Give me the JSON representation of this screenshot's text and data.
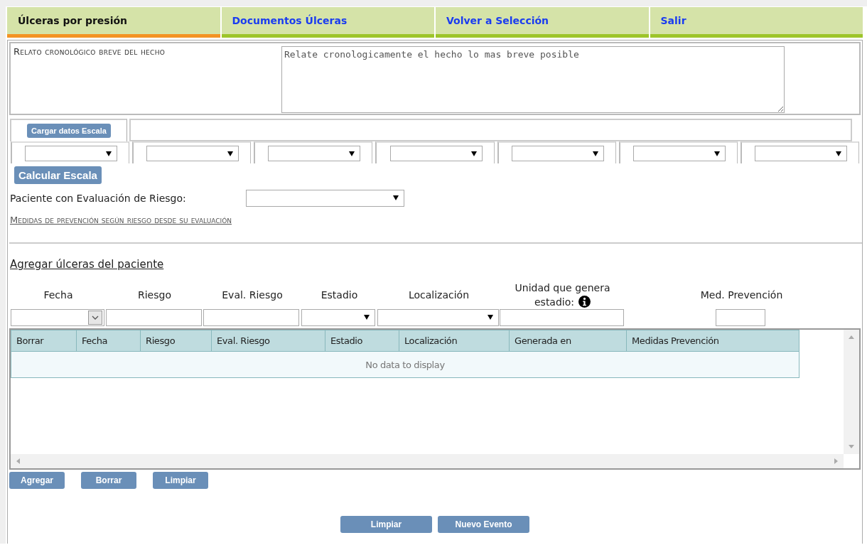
{
  "tabs": [
    {
      "label": "Úlceras por presión",
      "selected": true
    },
    {
      "label": "Documentos Úlceras",
      "selected": false
    },
    {
      "label": "Volver a Selección",
      "selected": false
    },
    {
      "label": "Salir",
      "selected": false
    }
  ],
  "relato": {
    "label": "Relato cronológico breve del hecho",
    "placeholder": "Relate cronologicamente el hecho lo mas breve posible"
  },
  "escala": {
    "load_button": "Cargar datos Escala",
    "calc_button": "Calcular Escala"
  },
  "riesgo": {
    "label": "Paciente con Evaluación de Riesgo:",
    "link": "Medidas de prevención según riesgo desde su evaluación"
  },
  "ulceras": {
    "link": "Agregar úlceras del paciente",
    "fields": [
      {
        "label": "Fecha",
        "kind": "date"
      },
      {
        "label": "Riesgo",
        "kind": "text"
      },
      {
        "label": "Eval. Riesgo",
        "kind": "text"
      },
      {
        "label": "Estadio",
        "kind": "select"
      },
      {
        "label": "Localización",
        "kind": "select"
      },
      {
        "label": "Unidad que genera estadio:",
        "kind": "text",
        "info": true
      },
      {
        "label": "Med. Prevención",
        "kind": "short"
      }
    ],
    "table": {
      "columns": [
        "Borrar",
        "Fecha",
        "Riesgo",
        "Eval. Riesgo",
        "Estadio",
        "Localización",
        "Generada en",
        "Medidas Prevención"
      ],
      "empty_text": "No data to display"
    },
    "buttons": [
      "Agregar",
      "Borrar",
      "Limpiar"
    ]
  },
  "footer_buttons": [
    "Limpiar",
    "Nuevo Evento"
  ]
}
